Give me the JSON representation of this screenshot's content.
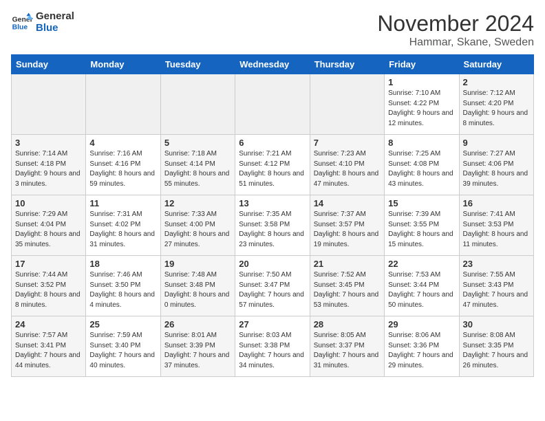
{
  "logo": {
    "general": "General",
    "blue": "Blue"
  },
  "title": "November 2024",
  "location": "Hammar, Skane, Sweden",
  "headers": [
    "Sunday",
    "Monday",
    "Tuesday",
    "Wednesday",
    "Thursday",
    "Friday",
    "Saturday"
  ],
  "weeks": [
    [
      {
        "day": "",
        "info": ""
      },
      {
        "day": "",
        "info": ""
      },
      {
        "day": "",
        "info": ""
      },
      {
        "day": "",
        "info": ""
      },
      {
        "day": "",
        "info": ""
      },
      {
        "day": "1",
        "info": "Sunrise: 7:10 AM\nSunset: 4:22 PM\nDaylight: 9 hours and 12 minutes."
      },
      {
        "day": "2",
        "info": "Sunrise: 7:12 AM\nSunset: 4:20 PM\nDaylight: 9 hours and 8 minutes."
      }
    ],
    [
      {
        "day": "3",
        "info": "Sunrise: 7:14 AM\nSunset: 4:18 PM\nDaylight: 9 hours and 3 minutes."
      },
      {
        "day": "4",
        "info": "Sunrise: 7:16 AM\nSunset: 4:16 PM\nDaylight: 8 hours and 59 minutes."
      },
      {
        "day": "5",
        "info": "Sunrise: 7:18 AM\nSunset: 4:14 PM\nDaylight: 8 hours and 55 minutes."
      },
      {
        "day": "6",
        "info": "Sunrise: 7:21 AM\nSunset: 4:12 PM\nDaylight: 8 hours and 51 minutes."
      },
      {
        "day": "7",
        "info": "Sunrise: 7:23 AM\nSunset: 4:10 PM\nDaylight: 8 hours and 47 minutes."
      },
      {
        "day": "8",
        "info": "Sunrise: 7:25 AM\nSunset: 4:08 PM\nDaylight: 8 hours and 43 minutes."
      },
      {
        "day": "9",
        "info": "Sunrise: 7:27 AM\nSunset: 4:06 PM\nDaylight: 8 hours and 39 minutes."
      }
    ],
    [
      {
        "day": "10",
        "info": "Sunrise: 7:29 AM\nSunset: 4:04 PM\nDaylight: 8 hours and 35 minutes."
      },
      {
        "day": "11",
        "info": "Sunrise: 7:31 AM\nSunset: 4:02 PM\nDaylight: 8 hours and 31 minutes."
      },
      {
        "day": "12",
        "info": "Sunrise: 7:33 AM\nSunset: 4:00 PM\nDaylight: 8 hours and 27 minutes."
      },
      {
        "day": "13",
        "info": "Sunrise: 7:35 AM\nSunset: 3:58 PM\nDaylight: 8 hours and 23 minutes."
      },
      {
        "day": "14",
        "info": "Sunrise: 7:37 AM\nSunset: 3:57 PM\nDaylight: 8 hours and 19 minutes."
      },
      {
        "day": "15",
        "info": "Sunrise: 7:39 AM\nSunset: 3:55 PM\nDaylight: 8 hours and 15 minutes."
      },
      {
        "day": "16",
        "info": "Sunrise: 7:41 AM\nSunset: 3:53 PM\nDaylight: 8 hours and 11 minutes."
      }
    ],
    [
      {
        "day": "17",
        "info": "Sunrise: 7:44 AM\nSunset: 3:52 PM\nDaylight: 8 hours and 8 minutes."
      },
      {
        "day": "18",
        "info": "Sunrise: 7:46 AM\nSunset: 3:50 PM\nDaylight: 8 hours and 4 minutes."
      },
      {
        "day": "19",
        "info": "Sunrise: 7:48 AM\nSunset: 3:48 PM\nDaylight: 8 hours and 0 minutes."
      },
      {
        "day": "20",
        "info": "Sunrise: 7:50 AM\nSunset: 3:47 PM\nDaylight: 7 hours and 57 minutes."
      },
      {
        "day": "21",
        "info": "Sunrise: 7:52 AM\nSunset: 3:45 PM\nDaylight: 7 hours and 53 minutes."
      },
      {
        "day": "22",
        "info": "Sunrise: 7:53 AM\nSunset: 3:44 PM\nDaylight: 7 hours and 50 minutes."
      },
      {
        "day": "23",
        "info": "Sunrise: 7:55 AM\nSunset: 3:43 PM\nDaylight: 7 hours and 47 minutes."
      }
    ],
    [
      {
        "day": "24",
        "info": "Sunrise: 7:57 AM\nSunset: 3:41 PM\nDaylight: 7 hours and 44 minutes."
      },
      {
        "day": "25",
        "info": "Sunrise: 7:59 AM\nSunset: 3:40 PM\nDaylight: 7 hours and 40 minutes."
      },
      {
        "day": "26",
        "info": "Sunrise: 8:01 AM\nSunset: 3:39 PM\nDaylight: 7 hours and 37 minutes."
      },
      {
        "day": "27",
        "info": "Sunrise: 8:03 AM\nSunset: 3:38 PM\nDaylight: 7 hours and 34 minutes."
      },
      {
        "day": "28",
        "info": "Sunrise: 8:05 AM\nSunset: 3:37 PM\nDaylight: 7 hours and 31 minutes."
      },
      {
        "day": "29",
        "info": "Sunrise: 8:06 AM\nSunset: 3:36 PM\nDaylight: 7 hours and 29 minutes."
      },
      {
        "day": "30",
        "info": "Sunrise: 8:08 AM\nSunset: 3:35 PM\nDaylight: 7 hours and 26 minutes."
      }
    ]
  ]
}
